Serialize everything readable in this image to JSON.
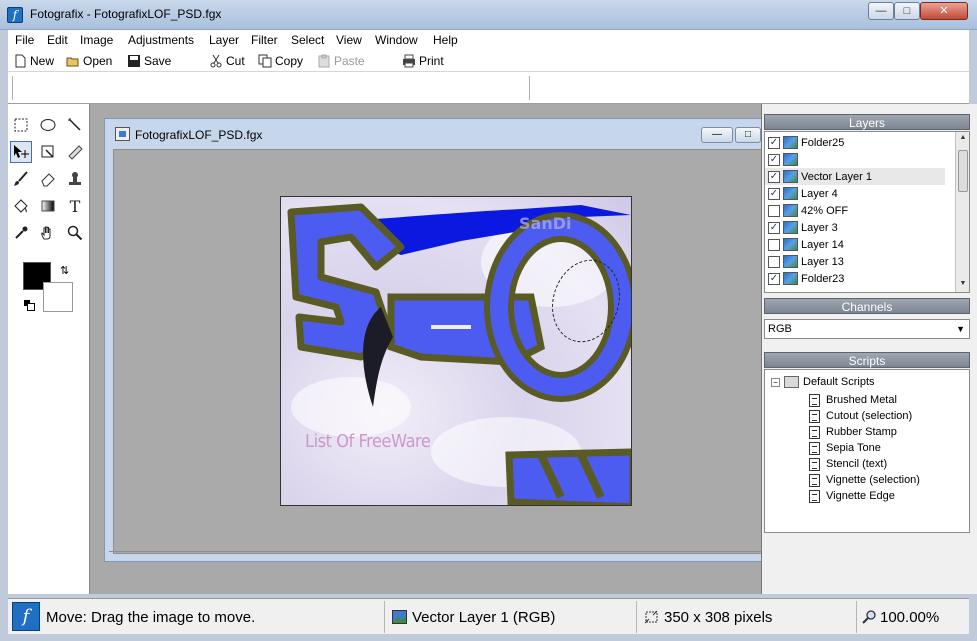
{
  "window": {
    "title": "Fotografix - FotografixLOF_PSD.fgx",
    "app_icon_glyph": "f"
  },
  "menu": [
    "File",
    "Edit",
    "Image",
    "Adjustments",
    "Layer",
    "Filter",
    "Select",
    "View",
    "Window",
    "Help"
  ],
  "toolbar": {
    "new": "New",
    "open": "Open",
    "save": "Save",
    "cut": "Cut",
    "copy": "Copy",
    "paste": "Paste",
    "print": "Print"
  },
  "document": {
    "title": "FotografixLOF_PSD.fgx",
    "watermark": "List Of FreeWare"
  },
  "panels": {
    "layers": {
      "title": "Layers",
      "items": [
        {
          "name": "Folder25",
          "checked": true
        },
        {
          "name": "",
          "checked": true
        },
        {
          "name": "Vector Layer 1",
          "checked": true,
          "selected": true
        },
        {
          "name": "Layer 4",
          "checked": true
        },
        {
          "name": "42% OFF",
          "checked": false
        },
        {
          "name": "Layer 3",
          "checked": true
        },
        {
          "name": "Layer 14",
          "checked": false
        },
        {
          "name": "Layer 13",
          "checked": false
        },
        {
          "name": "Folder23",
          "checked": true
        }
      ]
    },
    "channels": {
      "title": "Channels",
      "selected": "RGB"
    },
    "scripts": {
      "title": "Scripts",
      "root": "Default Scripts",
      "items": [
        "Brushed Metal",
        "Cutout (selection)",
        "Rubber Stamp",
        "Sepia Tone",
        "Stencil (text)",
        "Vignette (selection)",
        "Vignette Edge"
      ]
    }
  },
  "status": {
    "hint": "Move: Drag the image to move.",
    "layer": "Vector Layer 1 (RGB)",
    "size": "350 x 308 pixels",
    "zoom": "100.00%"
  },
  "colors": {
    "foreground": "#000000",
    "background": "#ffffff",
    "graffiti_blue": "#4a57e8",
    "graffiti_outline": "#5a5a2a"
  },
  "icons": {
    "tools": [
      "rect-select-icon",
      "ellipse-select-icon",
      "magic-wand-icon",
      "move-icon",
      "crop-icon",
      "measure-icon",
      "brush-icon",
      "eraser-icon",
      "clone-stamp-icon",
      "fill-bucket-icon",
      "gradient-icon",
      "text-icon",
      "eyedropper-icon",
      "hand-icon",
      "zoom-icon"
    ]
  }
}
